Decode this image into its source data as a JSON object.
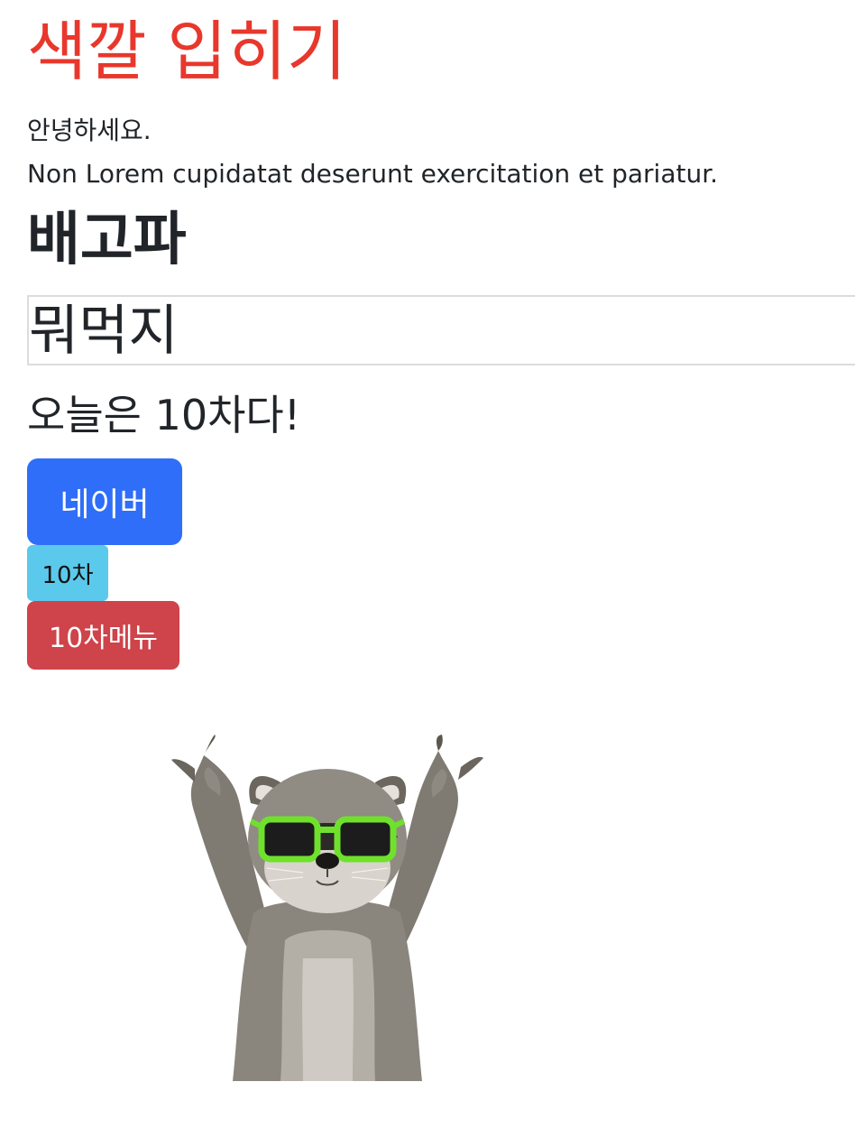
{
  "title": "색깔 입히기",
  "greeting": "안녕하세요.",
  "lorem": "Non Lorem cupidatat deserunt exercitation et pariatur.",
  "heading_hungry": "배고파",
  "box_text": "뭐먹지",
  "today_text": "오늘은 10차다!",
  "buttons": {
    "naver": "네이버",
    "cha10": "10차",
    "cha10_menu": "10차메뉴"
  },
  "colors": {
    "title": "#e8372c",
    "naver_button": "#2f6ef8",
    "cha10_button": "#5bc9ec",
    "menu_button": "#cf434a",
    "glasses": "#6fe12c"
  },
  "image": {
    "icon": "raccoon-with-sunglasses-image"
  }
}
